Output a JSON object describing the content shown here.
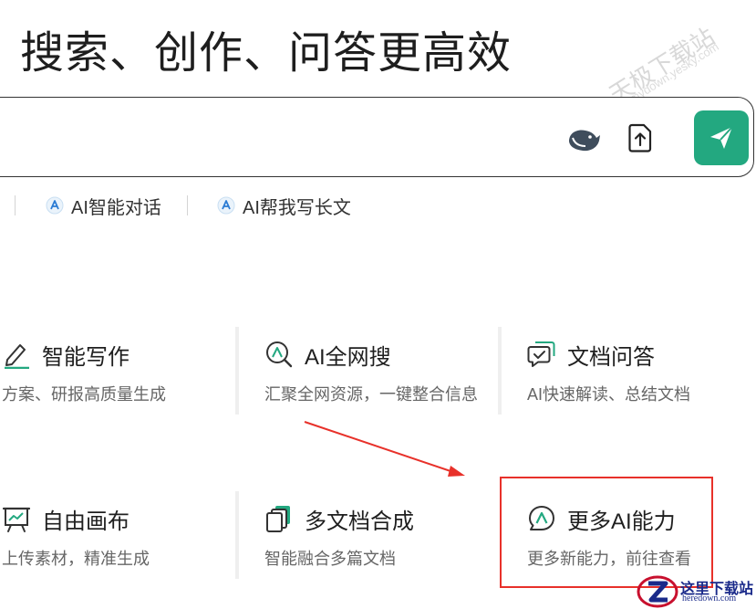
{
  "headline": "搜索、创作、问答更高效",
  "watermark": {
    "text": "天极下载站",
    "sub": "mydown.yesky.com"
  },
  "search": {
    "value": "",
    "placeholder": ""
  },
  "quick_links": [
    {
      "label": "AI智能对话",
      "icon": "ai-logo-icon"
    },
    {
      "label": "AI帮我写长文",
      "icon": "ai-logo-icon"
    }
  ],
  "cards": [
    {
      "title": "智能写作",
      "desc": "方案、研报高质量生成",
      "icon": "pen-icon"
    },
    {
      "title": "AI全网搜",
      "desc": "汇聚全网资源，一键整合信息",
      "icon": "search-ai-icon"
    },
    {
      "title": "文档问答",
      "desc": "AI快速解读、总结文档",
      "icon": "chat-doc-icon"
    },
    {
      "title": "自由画布",
      "desc": "上传素材，精准生成",
      "icon": "canvas-icon"
    },
    {
      "title": "多文档合成",
      "desc": "智能融合多篇文档",
      "icon": "multi-doc-icon"
    },
    {
      "title": "更多AI能力",
      "desc": "更多新能力，前往查看",
      "icon": "more-ai-icon"
    }
  ],
  "colors": {
    "accent": "#23a880",
    "annotation": "#e8312a"
  },
  "logo": {
    "main": "这里下载站",
    "sub": "heredown.com"
  }
}
